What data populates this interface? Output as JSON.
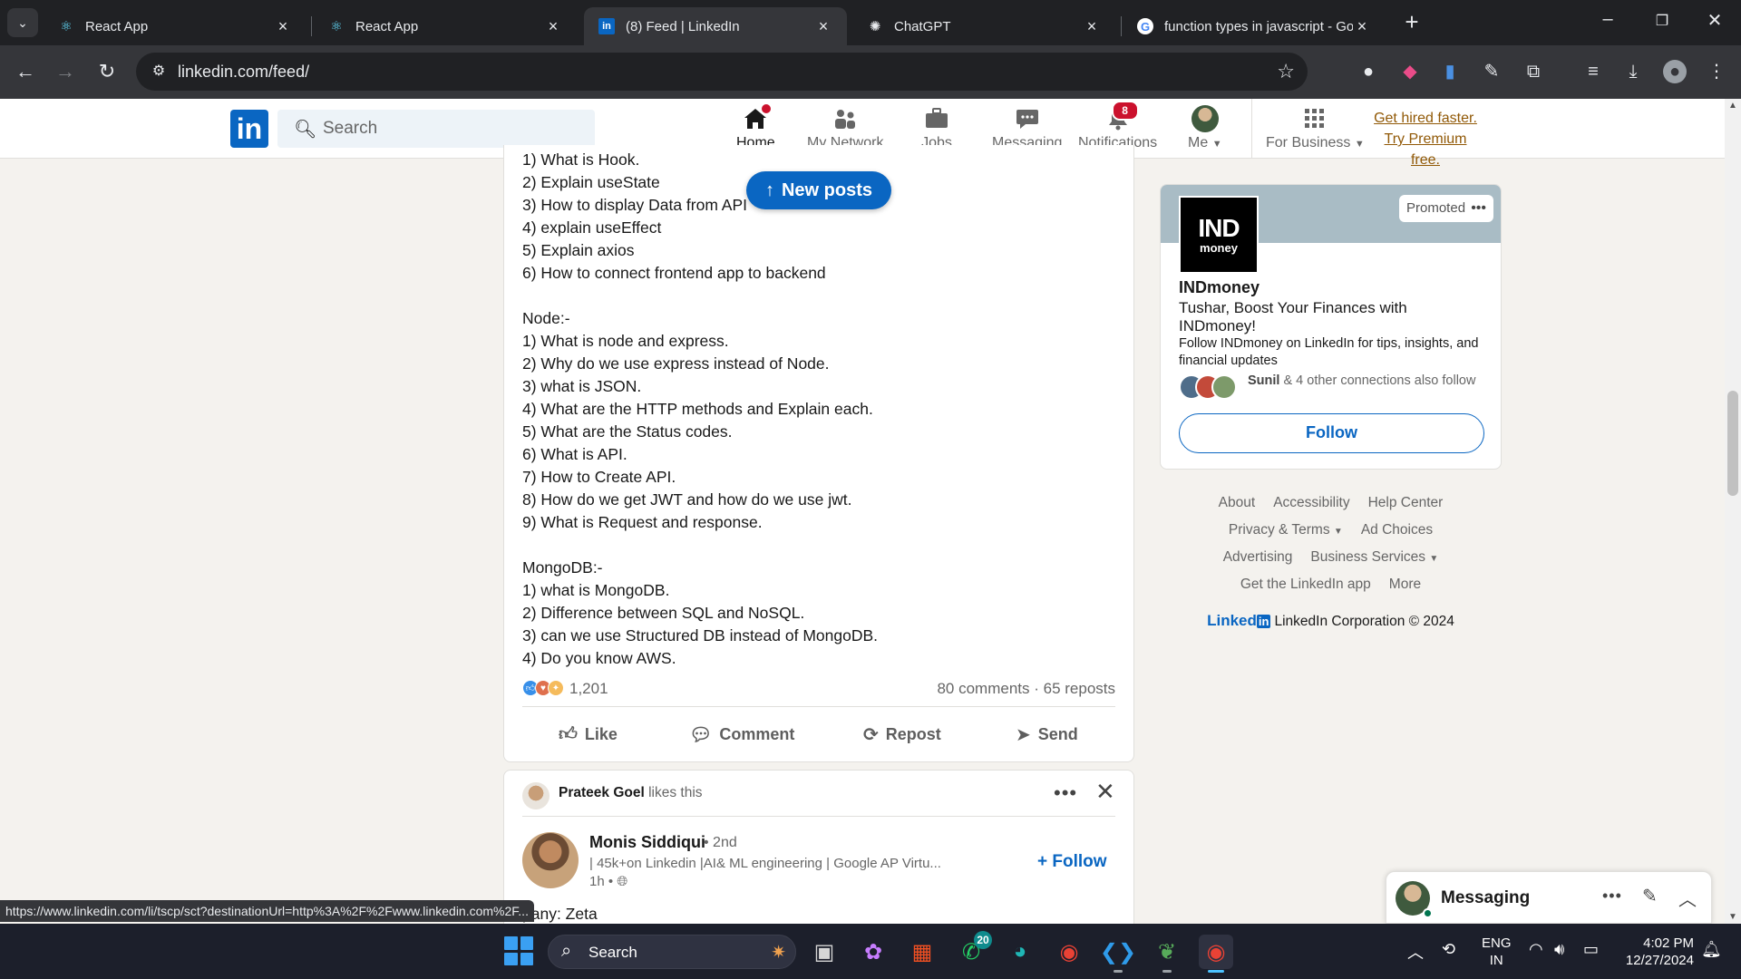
{
  "browser": {
    "tabs": [
      {
        "title": "React App",
        "favicon": "react-icon",
        "active": false
      },
      {
        "title": "React App",
        "favicon": "react-icon",
        "active": false
      },
      {
        "title": "(8) Feed | LinkedIn",
        "favicon": "linkedin-icon",
        "active": true
      },
      {
        "title": "ChatGPT",
        "favicon": "chatgpt-icon",
        "active": false
      },
      {
        "title": "function types in javascript - Go",
        "favicon": "google-icon",
        "active": false
      }
    ],
    "url": "linkedin.com/feed/",
    "status_url": "https://www.linkedin.com/li/tscp/sct?destinationUrl=http%3A%2F%2Fwww.linkedin.com%2F..."
  },
  "linkedin": {
    "search_placeholder": "Search",
    "nav": [
      {
        "label": "Home",
        "icon": "home-icon",
        "active": true,
        "badge": "dot"
      },
      {
        "label": "My Network",
        "icon": "network-icon",
        "active": false,
        "badge": ""
      },
      {
        "label": "Jobs",
        "icon": "briefcase-icon",
        "active": false,
        "badge": ""
      },
      {
        "label": "Messaging",
        "icon": "chat-icon",
        "active": false,
        "badge": ""
      },
      {
        "label": "Notifications",
        "icon": "bell-icon",
        "active": false,
        "badge": "8"
      },
      {
        "label": "Me",
        "icon": "avatar",
        "active": false,
        "badge": ""
      },
      {
        "label": "For Business",
        "icon": "grid-icon",
        "active": false,
        "badge": ""
      }
    ],
    "premium_link": "Get hired faster. Try Premium free."
  },
  "post": {
    "lines": [
      "1) What is Hook.",
      "2) Explain useState",
      "3) How to display Data from API",
      "4) explain useEffect",
      "5) Explain axios",
      "6) How to connect frontend app to backend",
      "",
      "Node:-",
      "1) What is node and express.",
      "2) Why do we use express instead of Node.",
      "3) what is JSON.",
      "4) What are the HTTP methods and Explain each.",
      "5) What are the Status codes.",
      "6) What is API.",
      "7) How to Create API.",
      "8) How do we get JWT and how do we use jwt.",
      "9) What is Request and response.",
      "",
      "MongoDB:-",
      "1) what is MongoDB.",
      "2) Difference between SQL and NoSQL.",
      "3) can we use Structured DB instead of MongoDB.",
      "4) Do you know AWS."
    ],
    "new_posts_label": "New posts",
    "reaction_count": "1,201",
    "comments_reposts": "80 comments · 65 reposts",
    "actions": {
      "like": "Like",
      "comment": "Comment",
      "repost": "Repost",
      "send": "Send"
    }
  },
  "post2": {
    "liker_name": "Prateek Goel",
    "liker_suffix": "likes this",
    "author_name": "Monis Siddiqui",
    "author_degree": "• 2nd",
    "author_headline": "| 45k+on Linkedin |AI& ML engineering | Google AP Virtu...",
    "author_time": "1h •",
    "follow_label": "Follow",
    "snippet": "pany: Zeta"
  },
  "ad": {
    "promoted_label": "Promoted",
    "logo_text": "IND",
    "logo_sub": "money",
    "company": "INDmoney",
    "headline": "Tushar, Boost Your Finances with INDmoney!",
    "description": "Follow INDmoney on LinkedIn for tips, insights, and financial updates",
    "connection_name": "Sunil",
    "connection_text": "& 4 other connections also follow",
    "follow_label": "Follow"
  },
  "footer": {
    "row1": [
      "About",
      "Accessibility",
      "Help Center"
    ],
    "row2": [
      "Privacy & Terms",
      "Ad Choices"
    ],
    "row3": [
      "Advertising",
      "Business Services"
    ],
    "row4": [
      "Get the LinkedIn app",
      "More"
    ],
    "logo_word": "Linked",
    "logo_box": "in",
    "copyright": "LinkedIn Corporation © 2024"
  },
  "messaging": {
    "title": "Messaging"
  },
  "taskbar": {
    "search_label": "Search",
    "whatsapp_badge": "20",
    "lang_line1": "ENG",
    "lang_line2": "IN",
    "time": "4:02 PM",
    "date": "12/27/2024"
  },
  "colors": {
    "linkedin_blue": "#0a66c2",
    "notification_red": "#cb112d",
    "premium_gold": "#915907"
  }
}
